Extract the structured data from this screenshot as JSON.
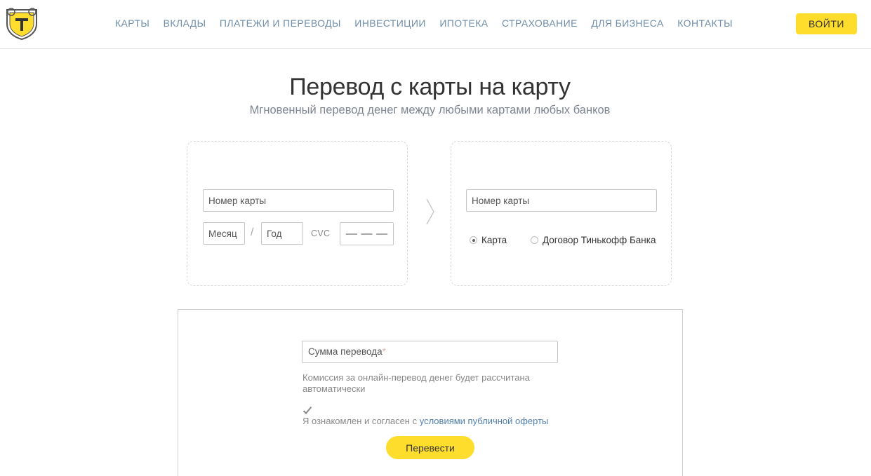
{
  "header": {
    "logo_icon": "tinkoff-shield-logo-icon",
    "nav": [
      {
        "label": "КАРТЫ"
      },
      {
        "label": "ВКЛАДЫ"
      },
      {
        "label": "ПЛАТЕЖИ И ПЕРЕВОДЫ"
      },
      {
        "label": "ИНВЕСТИЦИИ"
      },
      {
        "label": "ИПОТЕКА"
      },
      {
        "label": "СТРАХОВАНИЕ"
      },
      {
        "label": "ДЛЯ БИЗНЕСА"
      },
      {
        "label": "КОНТАКТЫ"
      }
    ],
    "login_label": "ВОЙТИ",
    "accent_color": "#ffdd2d"
  },
  "page": {
    "title": "Перевод с карты на карту",
    "subtitle": "Мгновенный перевод денег между любыми картами любых банков"
  },
  "from_card": {
    "card_number_placeholder": "Номер карты",
    "month_placeholder": "Месяц",
    "slash": "/",
    "year_placeholder": "Год",
    "cvc_label": "CVC",
    "cvc_mask": [
      "—",
      "—",
      "—"
    ]
  },
  "arrow_icon": "chevron-right-icon",
  "to_card": {
    "card_number_placeholder": "Номер карты",
    "options": [
      {
        "label": "Карта",
        "checked": true
      },
      {
        "label": "Договор Тинькофф Банка",
        "checked": false
      }
    ]
  },
  "amount": {
    "placeholder": "Сумма перевода",
    "required_mark": "*",
    "commission_text": "Комиссия за онлайн-перевод денег будет рассчитана автоматически",
    "agree_checked": true,
    "agree_text": "Я ознакомлен и согласен с ",
    "agree_link": "условиями публичной оферты",
    "submit_label": "Перевести"
  }
}
